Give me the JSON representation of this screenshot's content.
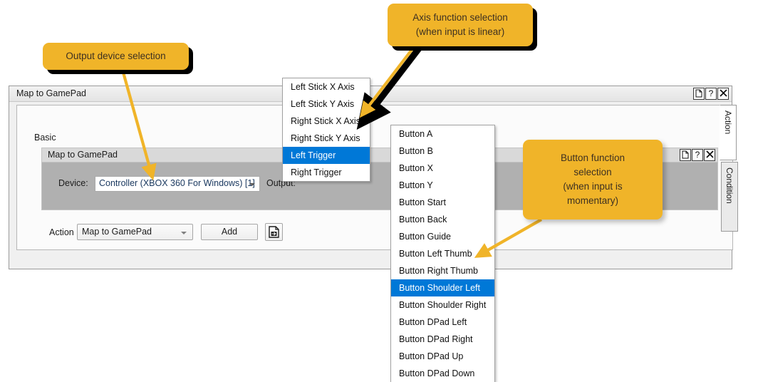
{
  "window": {
    "title": "Map to GamePad",
    "title_buttons": [
      {
        "name": "document-icon",
        "label": "⎘"
      },
      {
        "name": "help-icon",
        "label": "?"
      },
      {
        "name": "close-icon",
        "label": "✕"
      }
    ],
    "side_tabs": [
      {
        "label": "Action",
        "active": true
      },
      {
        "label": "Condition",
        "active": false
      }
    ]
  },
  "card": {
    "section_label": "Basic"
  },
  "inner_panel": {
    "title": "Map to GamePad",
    "title_buttons": [
      {
        "name": "document-icon",
        "label": "⎘"
      },
      {
        "name": "help-icon",
        "label": "?"
      },
      {
        "name": "close-icon",
        "label": "✕"
      }
    ],
    "device_label": "Device:",
    "device_value": "Controller (XBOX 360 For Windows) [1]",
    "output_label": "Output:"
  },
  "action_row": {
    "label": "Action",
    "value": "Map to GamePad",
    "add_button": "Add",
    "save_icon": "save-document-icon"
  },
  "axis_dropdown": {
    "items": [
      {
        "label": "Left Stick X Axis",
        "selected": false
      },
      {
        "label": "Left Stick Y Axis",
        "selected": false
      },
      {
        "label": "Right Stick X Axis",
        "selected": false
      },
      {
        "label": "Right Stick Y Axis",
        "selected": false
      },
      {
        "label": "Left Trigger",
        "selected": true
      },
      {
        "label": "Right Trigger",
        "selected": false
      }
    ]
  },
  "button_dropdown": {
    "items": [
      {
        "label": "Button A",
        "selected": false
      },
      {
        "label": "Button B",
        "selected": false
      },
      {
        "label": "Button X",
        "selected": false
      },
      {
        "label": "Button Y",
        "selected": false
      },
      {
        "label": "Button Start",
        "selected": false
      },
      {
        "label": "Button Back",
        "selected": false
      },
      {
        "label": "Button Guide",
        "selected": false
      },
      {
        "label": "Button Left Thumb",
        "selected": false
      },
      {
        "label": "Button Right Thumb",
        "selected": false
      },
      {
        "label": "Button Shoulder Left",
        "selected": true
      },
      {
        "label": "Button Shoulder Right",
        "selected": false
      },
      {
        "label": "Button DPad Left",
        "selected": false
      },
      {
        "label": "Button DPad Right",
        "selected": false
      },
      {
        "label": "Button DPad Up",
        "selected": false
      },
      {
        "label": "Button DPad Down",
        "selected": false
      }
    ]
  },
  "callouts": {
    "output_device": "Output device selection",
    "axis_function": "Axis function selection\n(when input is linear)",
    "button_function": "Button function\nselection\n(when input is\nmomentary)"
  },
  "colors": {
    "callout_fill": "#f0b429",
    "selection_blue": "#0078d7",
    "panel_grey": "#b0b0b0",
    "arrow_yellow": "#f0b429"
  }
}
